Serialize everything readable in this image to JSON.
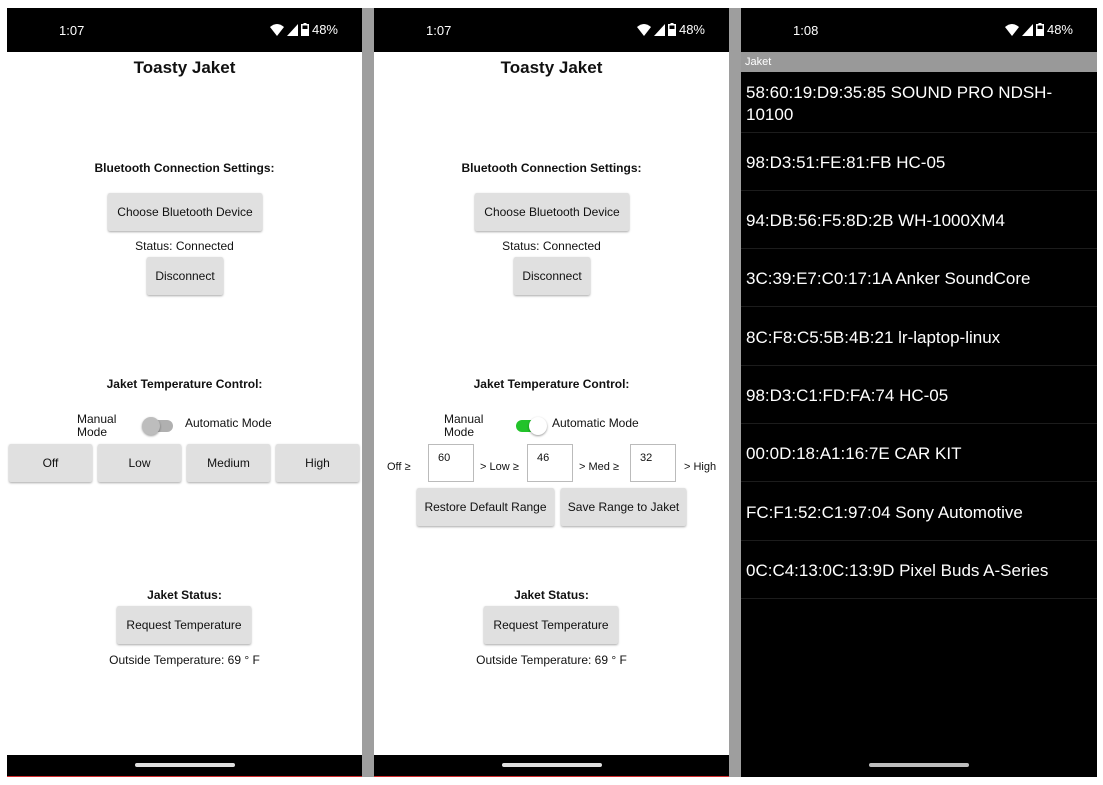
{
  "screens": [
    {
      "status": {
        "time": "1:07",
        "battery": "48%"
      },
      "title": "Toasty Jaket",
      "bt_heading": "Bluetooth Connection Settings:",
      "choose_device": "Choose Bluetooth Device",
      "status_text": "Status: Connected",
      "disconnect": "Disconnect",
      "temp_heading": "Jaket Temperature Control:",
      "manual_mode": "Manual Mode",
      "auto_mode": "Automatic Mode",
      "toggle_on": false,
      "levels": [
        "Off",
        "Low",
        "Medium",
        "High"
      ],
      "jaket_status_heading": "Jaket Status:",
      "request_temp": "Request Temperature",
      "outside_temp": "Outside Temperature: 69 ° F"
    },
    {
      "status": {
        "time": "1:07",
        "battery": "48%"
      },
      "title": "Toasty Jaket",
      "bt_heading": "Bluetooth Connection Settings:",
      "choose_device": "Choose Bluetooth Device",
      "status_text": "Status: Connected",
      "disconnect": "Disconnect",
      "temp_heading": "Jaket Temperature Control:",
      "manual_mode": "Manual Mode",
      "auto_mode": "Automatic Mode",
      "toggle_on": true,
      "range": {
        "off_label": "Off ≥",
        "off_value": "60",
        "low_label": "> Low ≥",
        "low_value": "46",
        "med_label": "> Med ≥",
        "med_value": "32",
        "high_label": "> High"
      },
      "restore_default": "Restore Default Range",
      "save_range": "Save Range to Jaket",
      "jaket_status_heading": "Jaket Status:",
      "request_temp": "Request Temperature",
      "outside_temp": "Outside Temperature: 69 ° F"
    },
    {
      "status": {
        "time": "1:08",
        "battery": "48%"
      },
      "list_title": "Jaket",
      "devices": [
        "58:60:19:D9:35:85 SOUND PRO NDSH-10100",
        "98:D3:51:FE:81:FB HC-05",
        "94:DB:56:F5:8D:2B WH-1000XM4",
        "3C:39:E7:C0:17:1A Anker SoundCore",
        "8C:F8:C5:5B:4B:21 lr-laptop-linux",
        "98:D3:C1:FD:FA:74 HC-05",
        "00:0D:18:A1:16:7E CAR KIT",
        "FC:F1:52:C1:97:04 Sony Automotive",
        "0C:C4:13:0C:13:9D Pixel Buds A-Series"
      ]
    }
  ],
  "colors": {
    "toggle_on": "#22c32a",
    "toggle_off": "#b0b0b0",
    "button_bg": "#e0e0e0",
    "list_header": "#999999"
  },
  "icons": [
    "wifi-icon",
    "signal-icon",
    "battery-icon"
  ]
}
